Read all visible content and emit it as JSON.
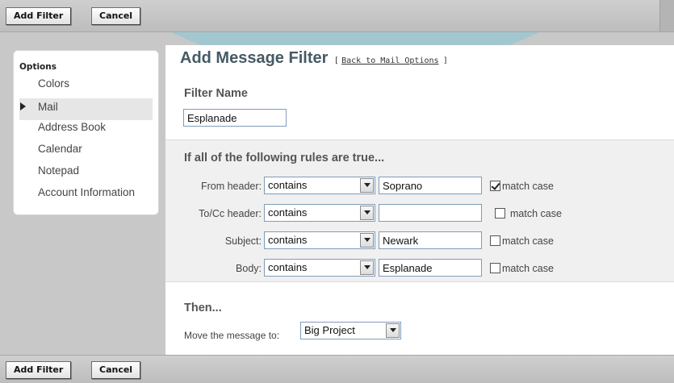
{
  "toolbar": {
    "add_filter_label": "Add Filter",
    "cancel_label": "Cancel"
  },
  "sidebar": {
    "heading": "Options",
    "items": [
      {
        "label": "Colors",
        "active": false
      },
      {
        "label": "Mail",
        "active": true
      },
      {
        "label": "Address Book",
        "active": false
      },
      {
        "label": "Calendar",
        "active": false
      },
      {
        "label": "Notepad",
        "active": false
      },
      {
        "label": "Account Information",
        "active": false
      }
    ]
  },
  "page": {
    "title": "Add Message Filter",
    "back_open": "[",
    "back_link": "Back to Mail Options",
    "back_close": "]"
  },
  "filter_name": {
    "label": "Filter Name",
    "value": "Esplanade"
  },
  "rules": {
    "heading": "If all of the following rules are true...",
    "rows": [
      {
        "label": "From header:",
        "operator": "contains",
        "value": "Soprano",
        "match_case": true,
        "match_label": "match case"
      },
      {
        "label": "To/Cc header:",
        "operator": "contains",
        "value": "",
        "match_case": false,
        "match_label": "match case"
      },
      {
        "label": "Subject:",
        "operator": "contains",
        "value": "Newark",
        "match_case": false,
        "match_label": "match case"
      },
      {
        "label": "Body:",
        "operator": "contains",
        "value": "Esplanade",
        "match_case": false,
        "match_label": "match case"
      }
    ]
  },
  "then": {
    "heading": "Then...",
    "action_label": "Move the message to:",
    "folder": "Big Project"
  },
  "colors": {
    "title": "#455a64",
    "accent_arc": "#40c4e2",
    "panel_bg": "#f0f0f0"
  }
}
